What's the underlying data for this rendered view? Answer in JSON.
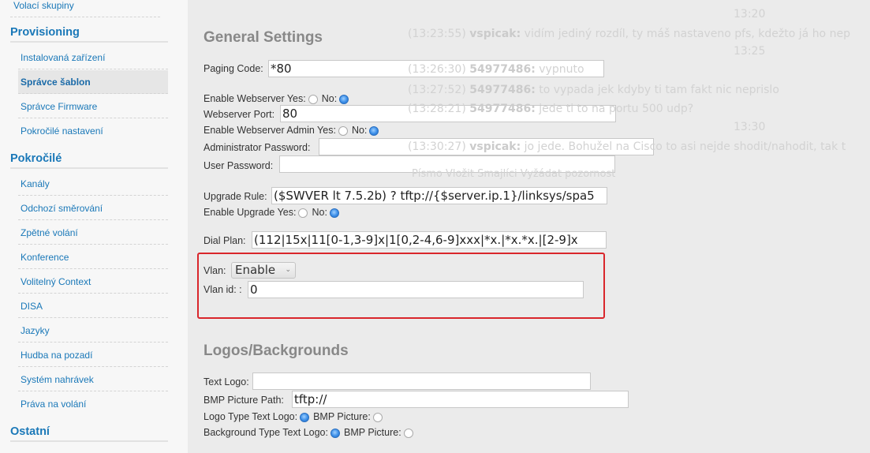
{
  "sidebar": {
    "top_item": "Volací skupiny",
    "sections": [
      {
        "title": "Provisioning",
        "items": [
          "Instalovaná zařízení",
          "Správce šablon",
          "Správce Firmware",
          "Pokročilé nastavení"
        ]
      },
      {
        "title": "Pokročilé",
        "items": [
          "Kanály",
          "Odchozí směrování",
          "Zpětné volání",
          "Konference",
          "Volitelný Context",
          "DISA",
          "Jazyky",
          "Hudba na pozadí",
          "Systém nahrávek",
          "Práva na volání"
        ]
      },
      {
        "title": "Ostatní",
        "items": []
      }
    ],
    "selected": "Správce šablon"
  },
  "general": {
    "title": "General Settings",
    "paging_code_label": "Paging Code:",
    "paging_code": "*80",
    "webserver_label": "Enable Webserver Yes:",
    "no_label": "No:",
    "webserver_enabled": false,
    "port_label": "Webserver Port:",
    "port": "80",
    "admin_label": "Enable Webserver Admin Yes:",
    "admin_enabled": false,
    "admin_pw_label": "Administrator Password:",
    "admin_pw": "",
    "user_pw_label": "User Password:",
    "user_pw": "",
    "upgrade_rule_label": "Upgrade Rule:",
    "upgrade_rule": "($SWVER lt 7.5.2b) ? tftp://{$server.ip.1}/linksys/spa5",
    "upgrade_label": "Enable Upgrade Yes:",
    "upgrade_enabled": false,
    "dial_plan_label": "Dial Plan:",
    "dial_plan": "(112|15x|11[0-1,3-9]x|1[0,2-4,6-9]xxx|*x.|*x.*x.|[2-9]x"
  },
  "vlan": {
    "label": "Vlan:",
    "value": "Enable",
    "id_label": "Vlan id: :",
    "id": "0",
    "highlight_color": "#d9262b"
  },
  "logos": {
    "title": "Logos/Backgrounds",
    "text_logo_label": "Text Logo:",
    "text_logo": "",
    "bmp_path_label": "BMP Picture Path:",
    "bmp_path": "tftp://",
    "logo_type_label": "Logo Type Text Logo:",
    "bmp_label": "BMP Picture:",
    "bg_type_label": "Background Type Text Logo:",
    "logo_type": "Text Logo",
    "bg_type": "Text Logo"
  },
  "ghost_chat": {
    "times": [
      "13:20",
      "13:25",
      "13:30"
    ],
    "lines": [
      {
        "t": "(13:23:55)",
        "who": "vspicak:",
        "msg": "vidím jediný rozdíl, ty máš nastaveno pfs, kdežto já ho nep"
      },
      {
        "t": "(13:26:30)",
        "who": "54977486:",
        "msg": "vypnuto"
      },
      {
        "t": "(13:27:52)",
        "who": "54977486:",
        "msg": "to vypada jek kdyby ti tam fakt nic neprislo"
      },
      {
        "t": "(13:28:21)",
        "who": "54977486:",
        "msg": "jede ti to na portu 500 udp?"
      },
      {
        "t": "(13:30:27)",
        "who": "vspicak:",
        "msg": "jo jede. Bohužel na Cisco to asi nejde shodit/nahodit, tak t"
      }
    ],
    "toolbar": "Písmo   Vložit   Smajlíci   Vyžádat pozornost"
  }
}
